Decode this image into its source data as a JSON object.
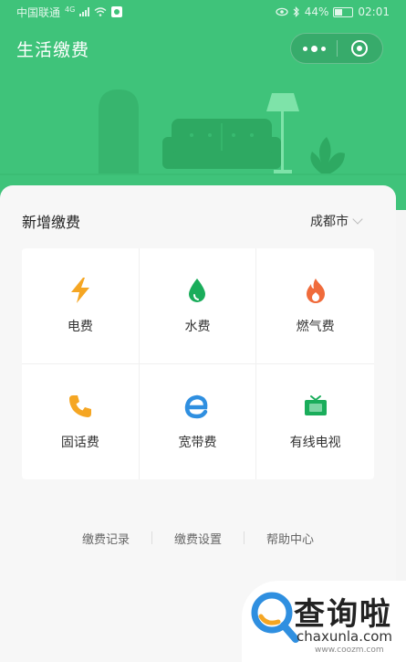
{
  "status_bar": {
    "carrier": "中国联通",
    "signal_type": "4G",
    "battery": "44%",
    "time": "02:01"
  },
  "titlebar": {
    "title": "生活缴费"
  },
  "section": {
    "title": "新增缴费",
    "city": "成都市"
  },
  "services": [
    {
      "label": "电费",
      "icon": "lightning-icon",
      "color": "#f5a623"
    },
    {
      "label": "水费",
      "icon": "water-drop-icon",
      "color": "#1aad5b"
    },
    {
      "label": "燃气费",
      "icon": "flame-icon",
      "color": "#f06b3b"
    },
    {
      "label": "固话费",
      "icon": "phone-icon",
      "color": "#f5a623"
    },
    {
      "label": "宽带费",
      "icon": "broadband-e-icon",
      "color": "#2f8fe0"
    },
    {
      "label": "有线电视",
      "icon": "tv-icon",
      "color": "#1aad5b"
    }
  ],
  "links": {
    "records": "缴费记录",
    "settings": "缴费设置",
    "help": "帮助中心"
  },
  "watermark": {
    "text": "查询啦",
    "domain": "chaxunla.com",
    "small": "www.coozm.com"
  },
  "colors": {
    "header_green": "#3fc37a",
    "background": "#f7f7f7"
  }
}
